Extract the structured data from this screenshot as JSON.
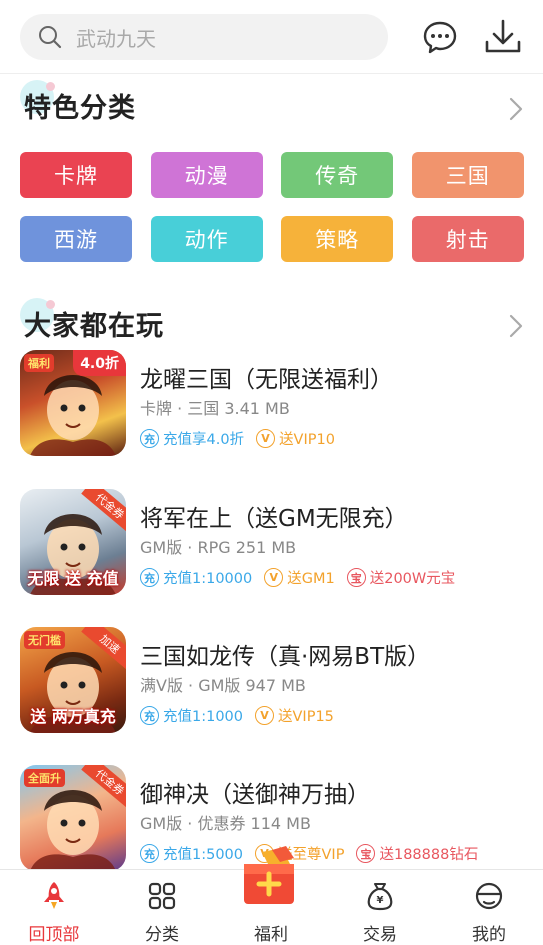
{
  "search": {
    "placeholder": "武动九天"
  },
  "header_icons": [
    "message-icon",
    "download-icon"
  ],
  "sections": {
    "featured": {
      "title": "特色分类"
    },
    "popular": {
      "title": "大家都在玩"
    }
  },
  "categories": [
    {
      "label": "卡牌",
      "color": "#ea4352"
    },
    {
      "label": "动漫",
      "color": "#cf74d6"
    },
    {
      "label": "传奇",
      "color": "#73c878"
    },
    {
      "label": "三国",
      "color": "#f1946d"
    },
    {
      "label": "西游",
      "color": "#6f93dc"
    },
    {
      "label": "动作",
      "color": "#48cfd8"
    },
    {
      "label": "策略",
      "color": "#f6b23a"
    },
    {
      "label": "射击",
      "color": "#ea6a6a"
    }
  ],
  "games": [
    {
      "name": "龙曜三国（无限送福利）",
      "meta": "卡牌 · 三国  3.41 MB",
      "thumb_badge": "4.0折",
      "thumb_tag": "福利",
      "tags": [
        {
          "icon_char": "充",
          "text": "充值享4.0折",
          "style": "blue"
        },
        {
          "icon_char": "V",
          "text": "送VIP10",
          "style": "orange"
        }
      ]
    },
    {
      "name": "将军在上（送GM无限充）",
      "meta": "GM版 · RPG  251 MB",
      "thumb_corner": "代金券",
      "thumb_caption": "无限 送 充值",
      "tags": [
        {
          "icon_char": "充",
          "text": "充值1:10000",
          "style": "blue"
        },
        {
          "icon_char": "V",
          "text": "送GM1",
          "style": "orange"
        },
        {
          "icon_char": "宝",
          "text": "送200W元宝",
          "style": "red"
        }
      ]
    },
    {
      "name": "三国如龙传（真·网易BT版）",
      "meta": "满V版 · GM版  947 MB",
      "thumb_corner": "加速",
      "thumb_tag": "无门槛",
      "thumb_caption": "送 两万真充",
      "tags": [
        {
          "icon_char": "充",
          "text": "充值1:1000",
          "style": "blue"
        },
        {
          "icon_char": "V",
          "text": "送VIP15",
          "style": "orange"
        }
      ]
    },
    {
      "name": "御神决（送御神万抽）",
      "meta": "GM版 · 优惠券  114 MB",
      "thumb_corner": "代金券",
      "thumb_tag": "全面升",
      "tags": [
        {
          "icon_char": "充",
          "text": "充值1:5000",
          "style": "blue"
        },
        {
          "icon_char": "V",
          "text": "送至尊VIP",
          "style": "orange"
        },
        {
          "icon_char": "宝",
          "text": "送188888钻石",
          "style": "red"
        }
      ]
    }
  ],
  "nav": [
    {
      "label": "回顶部",
      "icon": "rocket-icon",
      "active": true
    },
    {
      "label": "分类",
      "icon": "grid-icon",
      "active": false
    },
    {
      "label": "福利",
      "icon": "gift-icon",
      "active": false
    },
    {
      "label": "交易",
      "icon": "money-bag-icon",
      "active": false
    },
    {
      "label": "我的",
      "icon": "user-icon",
      "active": false
    }
  ],
  "colors": {
    "accent": "#e8373b",
    "tag_blue": "#3aa8e8",
    "tag_orange": "#f3a22c",
    "tag_red": "#e8575f"
  }
}
